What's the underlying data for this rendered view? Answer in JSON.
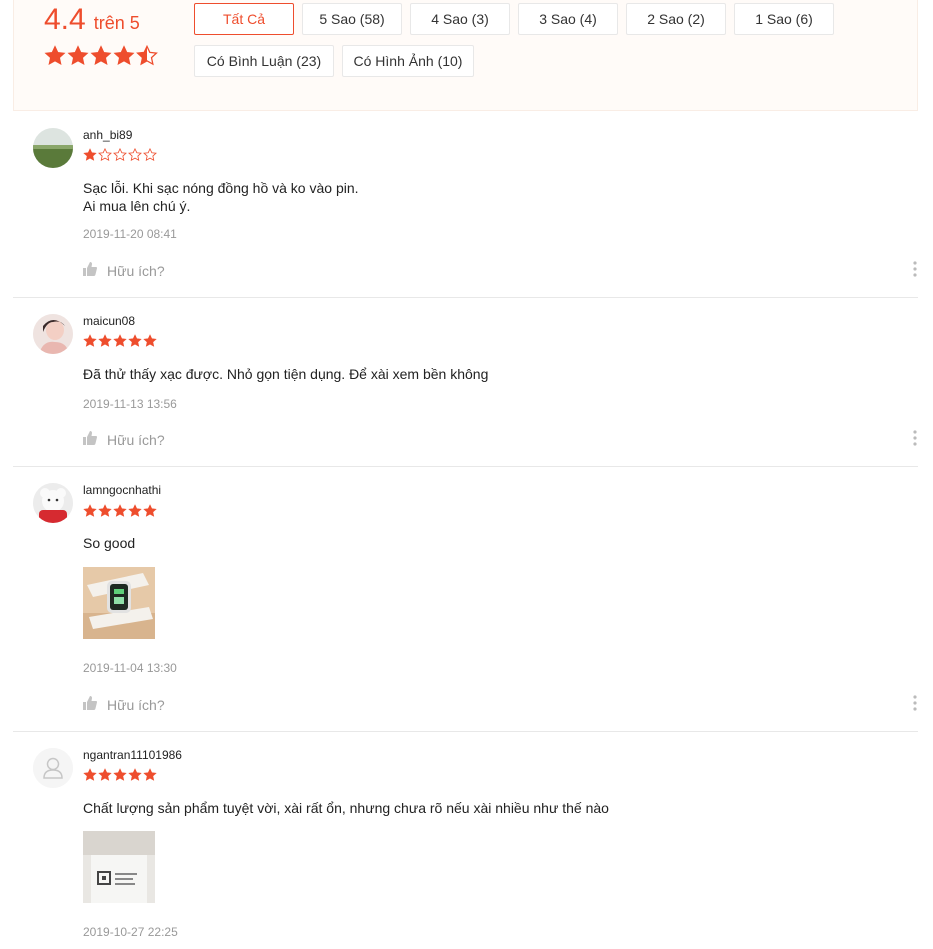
{
  "summary": {
    "score": "4.4",
    "score_suffix": "trên 5",
    "stars": [
      1,
      1,
      1,
      1,
      0.5
    ],
    "accent_color": "#ee4d2d"
  },
  "filters": [
    {
      "label": "Tất Cả",
      "active": true
    },
    {
      "label": "5 Sao (58)",
      "active": false
    },
    {
      "label": "4 Sao (3)",
      "active": false
    },
    {
      "label": "3 Sao (4)",
      "active": false
    },
    {
      "label": "2 Sao (2)",
      "active": false
    },
    {
      "label": "1 Sao (6)",
      "active": false
    },
    {
      "label": "Có Bình Luận (23)",
      "active": false
    },
    {
      "label": "Có Hình Ảnh (10)",
      "active": false
    }
  ],
  "reviews": [
    {
      "username": "anh_bi89",
      "rating": 1,
      "comment_lines": [
        "Sạc lỗi. Khi sạc nóng đồng hồ và ko vào pin.",
        "Ai mua lên chú ý."
      ],
      "time": "2019-11-20 08:41",
      "helpful_label": "Hữu ích?",
      "avatar_icon": "landscape-photo"
    },
    {
      "username": "maicun08",
      "rating": 5,
      "comment_lines": [
        "Đã thử thấy xạc được. Nhỏ gọn tiện dụng. Để xài xem bền không"
      ],
      "time": "2019-11-13 13:56",
      "helpful_label": "Hữu ích?",
      "avatar_icon": "person-photo"
    },
    {
      "username": "lamngocnhathi",
      "rating": 5,
      "comment_lines": [
        "So good"
      ],
      "time": "2019-11-04 13:30",
      "helpful_label": "Hữu ích?",
      "avatar_icon": "bear-photo",
      "photo": "watch-photo"
    },
    {
      "username": "ngantran11101986",
      "rating": 5,
      "comment_lines": [
        "Chất lượng sản phẩm tuyệt vời, xài rất ổn, nhưng chưa rõ nếu xài nhiều như thế nào"
      ],
      "time": "2019-10-27 22:25",
      "helpful_label": "Hữu ích?",
      "avatar_icon": "default-user-icon",
      "photo": "package-photo"
    }
  ]
}
